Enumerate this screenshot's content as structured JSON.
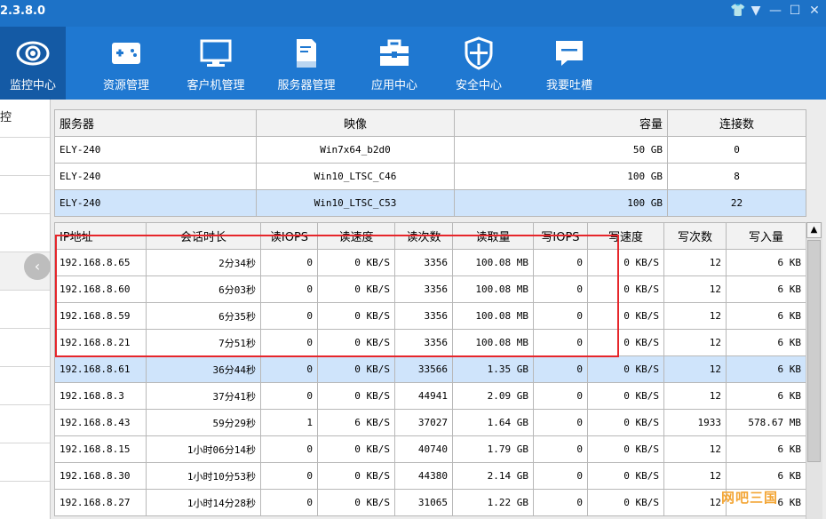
{
  "app": {
    "version": "2.3.8.0"
  },
  "window_controls": [
    "shirt-icon",
    "dropdown-icon",
    "minimize-icon",
    "maximize-icon",
    "close-icon"
  ],
  "toolbar": [
    {
      "label": "监控中心",
      "icon": "eye-icon",
      "active": true
    },
    {
      "label": "资源管理",
      "icon": "gamepad-icon"
    },
    {
      "label": "客户机管理",
      "icon": "monitor-icon"
    },
    {
      "label": "服务器管理",
      "icon": "document-icon"
    },
    {
      "label": "应用中心",
      "icon": "toolbox-icon"
    },
    {
      "label": "安全中心",
      "icon": "shield-icon"
    },
    {
      "label": "我要吐槽",
      "icon": "chat-icon"
    }
  ],
  "leftnav": [
    "控",
    "",
    "",
    "",
    "",
    "",
    "",
    "",
    "",
    ""
  ],
  "servers": {
    "headers": [
      "服务器",
      "映像",
      "容量",
      "连接数"
    ],
    "rows": [
      [
        "ELY-240",
        "Win7x64_b2d0",
        "50 GB",
        "0"
      ],
      [
        "ELY-240",
        "Win10_LTSC_C46",
        "100 GB",
        "8"
      ],
      [
        "ELY-240",
        "Win10_LTSC_C53",
        "100 GB",
        "22"
      ]
    ],
    "selected_row": 2
  },
  "sessions": {
    "headers": [
      "IP地址",
      "会话时长",
      "读IOPS",
      "读速度",
      "读次数",
      "读取量",
      "写IOPS",
      "写速度",
      "写次数",
      "写入量"
    ],
    "rows": [
      [
        "192.168.8.65",
        "2分34秒",
        "0",
        "0 KB/S",
        "3356",
        "100.08 MB",
        "0",
        "0 KB/S",
        "12",
        "6 KB"
      ],
      [
        "192.168.8.60",
        "6分03秒",
        "0",
        "0 KB/S",
        "3356",
        "100.08 MB",
        "0",
        "0 KB/S",
        "12",
        "6 KB"
      ],
      [
        "192.168.8.59",
        "6分35秒",
        "0",
        "0 KB/S",
        "3356",
        "100.08 MB",
        "0",
        "0 KB/S",
        "12",
        "6 KB"
      ],
      [
        "192.168.8.21",
        "7分51秒",
        "0",
        "0 KB/S",
        "3356",
        "100.08 MB",
        "0",
        "0 KB/S",
        "12",
        "6 KB"
      ],
      [
        "192.168.8.61",
        "36分44秒",
        "0",
        "0 KB/S",
        "33566",
        "1.35 GB",
        "0",
        "0 KB/S",
        "12",
        "6 KB"
      ],
      [
        "192.168.8.3",
        "37分41秒",
        "0",
        "0 KB/S",
        "44941",
        "2.09 GB",
        "0",
        "0 KB/S",
        "12",
        "6 KB"
      ],
      [
        "192.168.8.43",
        "59分29秒",
        "1",
        "6 KB/S",
        "37027",
        "1.64 GB",
        "0",
        "0 KB/S",
        "1933",
        "578.67 MB"
      ],
      [
        "192.168.8.15",
        "1小时06分14秒",
        "0",
        "0 KB/S",
        "40740",
        "1.79 GB",
        "0",
        "0 KB/S",
        "12",
        "6 KB"
      ],
      [
        "192.168.8.30",
        "1小时10分53秒",
        "0",
        "0 KB/S",
        "44380",
        "2.14 GB",
        "0",
        "0 KB/S",
        "12",
        "6 KB"
      ],
      [
        "192.168.8.27",
        "1小时14分28秒",
        "0",
        "0 KB/S",
        "31065",
        "1.22 GB",
        "0",
        "0 KB/S",
        "12",
        "6 KB"
      ]
    ],
    "selected_row": 4
  },
  "watermark": "网吧三国",
  "colors": {
    "toolbar": "#1f78d1",
    "active_tool": "#145aa5",
    "selection": "#cfe4fb",
    "highlight_box": "#e6262b"
  }
}
